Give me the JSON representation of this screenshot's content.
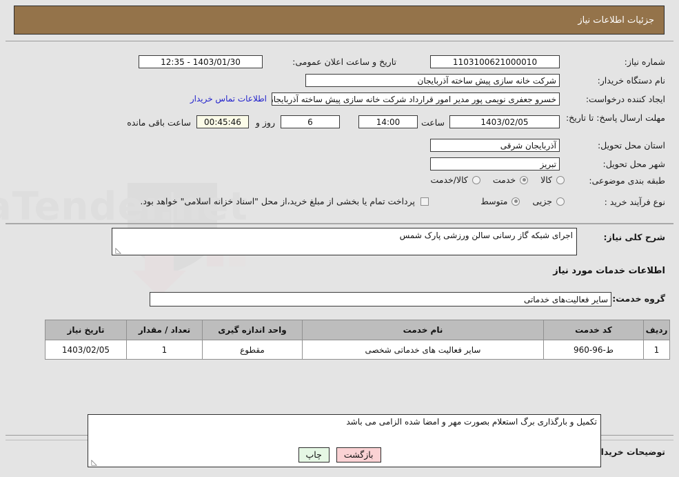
{
  "header": {
    "title": "جزئیات اطلاعات نیاز"
  },
  "details": {
    "need_number_label": "شماره نیاز:",
    "need_number_value": "1103100621000010",
    "public_announcement_label": "تاریخ و ساعت اعلان عمومی:",
    "public_announcement_value": "1403/01/30 - 12:35",
    "buyer_org_label": "نام دستگاه خریدار:",
    "buyer_org_value": "شرکت خانه سازی پیش ساخته آذربایجان",
    "creator_label": "ایجاد کننده درخواست:",
    "creator_value": "خسرو جعفری نویمی پور مدیر امور قرارداد شرکت خانه سازی پیش ساخته آذربایجان",
    "contact_link": "اطلاعات تماس خریدار",
    "deadline_label": "مهلت ارسال پاسخ: تا تاریخ:",
    "deadline_date": "1403/02/05",
    "deadline_hour_label": "ساعت",
    "deadline_hour_value": "14:00",
    "remaining_days": "6",
    "remaining_days_label": "روز و",
    "remaining_time": "00:45:46",
    "remaining_time_label": "ساعت باقی مانده",
    "province_label": "استان محل تحویل:",
    "province_value": "آذربایجان شرقی",
    "city_label": "شهر محل تحویل:",
    "city_value": "تبریز",
    "category_label": "طبقه بندی موضوعی:",
    "category_options": [
      {
        "label": "کالا",
        "selected": false
      },
      {
        "label": "خدمت",
        "selected": true
      },
      {
        "label": "کالا/خدمت",
        "selected": false
      }
    ],
    "process_type_label": "نوع فرآیند خرید :",
    "process_type_options": [
      {
        "label": "جزیی",
        "selected": false
      },
      {
        "label": "متوسط",
        "selected": true
      }
    ],
    "treasury_checkbox_label": "پرداخت تمام یا بخشی از مبلغ خرید،از محل \"اسناد خزانه اسلامی\" خواهد بود.",
    "treasury_checked": false
  },
  "description": {
    "general_label": "شرح کلی نیاز:",
    "general_value": "اجرای شبکه گاز رسانی سالن ورزشی پارک شمس",
    "services_heading": "اطلاعات خدمات مورد نیاز",
    "service_group_label": "گروه خدمت:",
    "service_group_value": "سایر فعالیت‌های خدماتی"
  },
  "items_table": {
    "columns": [
      "ردیف",
      "کد خدمت",
      "نام خدمت",
      "واحد اندازه گیری",
      "تعداد / مقدار",
      "تاریخ نیاز"
    ],
    "rows": [
      {
        "row_no": "1",
        "service_code": "ط-96-960",
        "service_name": "سایر فعالیت های خدماتی شخصی",
        "unit": "مقطوع",
        "quantity": "1",
        "need_date": "1403/02/05"
      }
    ]
  },
  "buyer_notes": {
    "label": "توضیحات خریدار:",
    "value": "تکمیل و بارگذاری برگ استعلام بصورت مهر و امضا شده الزامی می باشد"
  },
  "footer": {
    "print_label": "چاپ",
    "back_label": "بازگشت"
  },
  "watermark": {
    "text": "AriaTender.net"
  },
  "colors": {
    "header_bg": "#94734a",
    "page_bg": "#e4e4e4",
    "link": "#2222cc",
    "back_btn": "#fad2d4",
    "print_btn": "#e5f7e4",
    "timer_bg": "#fbfbe8",
    "table_header_bg": "#bdbdbd"
  }
}
